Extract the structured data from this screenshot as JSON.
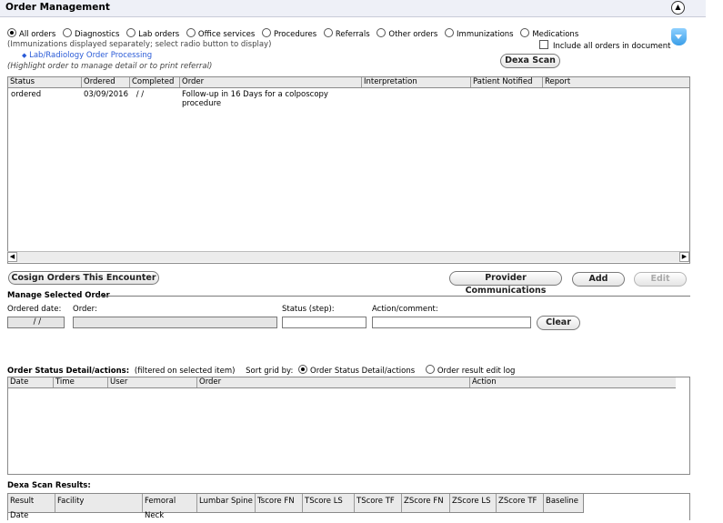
{
  "header": {
    "title": "Order Management",
    "collapse_glyph": "▲"
  },
  "filters": {
    "options": [
      "All orders",
      "Diagnostics",
      "Lab orders",
      "Office services",
      "Procedures",
      "Referrals",
      "Other orders",
      "Immunizations",
      "Medications"
    ],
    "selected": "All orders",
    "immunizations_note": "(Immunizations displayed separately; select radio button to display)",
    "include_all_label": "Include all orders in document",
    "lab_link": "Lab/Radiology Order Processing",
    "highlight_note": "(Highlight order to manage detail or to print referral)",
    "dexa_button": "Dexa Scan",
    "link_icon": "diamond-link-icon",
    "dropdown_icon": "blue-chevron-down-icon"
  },
  "orders_grid": {
    "columns": [
      "Status",
      "Ordered",
      "Completed",
      "Order",
      "Interpretation",
      "Patient Notified",
      "Report"
    ],
    "rows": [
      {
        "status": "ordered",
        "ordered": "03/09/2016",
        "completed": " / /",
        "order_line1": "Follow-up in 16 Days for a colposcopy",
        "order_line2": "procedure",
        "interpretation": "",
        "patient_notified": "",
        "report": ""
      }
    ]
  },
  "actions": {
    "cosign": "Cosign Orders This Encounter",
    "provider_comm": "Provider Communications",
    "add": "Add",
    "edit": "Edit"
  },
  "manage": {
    "section_title": "Manage Selected Order",
    "ordered_date_label": "Ordered date:",
    "ordered_date_value": " / /",
    "order_label": "Order:",
    "order_value": "",
    "status_label": "Status (step):",
    "status_value": "",
    "action_label": "Action/comment:",
    "action_value": "",
    "clear": "Clear"
  },
  "status_detail": {
    "title": "Order Status Detail/actions:",
    "filter_note": "(filtered on selected item)",
    "sort_label": "Sort grid by:",
    "sort_options": [
      "Order Status Detail/actions",
      "Order result edit log"
    ],
    "sort_selected": "Order Status Detail/actions",
    "columns": [
      "Date",
      "Time",
      "User",
      "Order",
      "Action"
    ]
  },
  "dexa": {
    "title": "Dexa Scan Results:",
    "columns": [
      "Result Date",
      "Facility",
      "Femoral Neck",
      "Lumbar Spine",
      "Tscore FN",
      "TScore LS",
      "TScore TF",
      "ZScore FN",
      "ZScore LS",
      "ZScore TF",
      "Baseline"
    ]
  },
  "colors": {
    "header_bg": "#eef0f7",
    "link": "#2a5bd7",
    "grid_header_bg": "#eaeaea",
    "disabled_text": "#aaaaaa"
  }
}
